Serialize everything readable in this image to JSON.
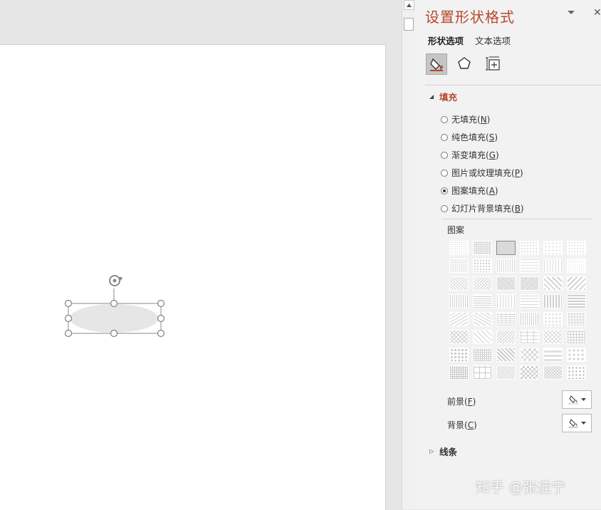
{
  "panel": {
    "title": "设置形状格式",
    "tabs": [
      {
        "label": "形状选项",
        "active": true
      },
      {
        "label": "文本选项",
        "active": false
      }
    ],
    "category_icons": [
      "fill-line-icon",
      "effects-pentagon-icon",
      "size-properties-icon"
    ]
  },
  "fill_section": {
    "header": "填充",
    "options": [
      {
        "label": "无填充(N)",
        "text": "无填充(",
        "key": "N",
        "end": ")",
        "checked": false
      },
      {
        "label": "纯色填充(S)",
        "text": "纯色填充(",
        "key": "S",
        "end": ")",
        "checked": false
      },
      {
        "label": "渐变填充(G)",
        "text": "渐变填充(",
        "key": "G",
        "end": ")",
        "checked": false
      },
      {
        "label": "图片或纹理填充(P)",
        "text": "图片或纹理填充(",
        "key": "P",
        "end": ")",
        "checked": false
      },
      {
        "label": "图案填充(A)",
        "text": "图案填充(",
        "key": "A",
        "end": ")",
        "checked": true
      },
      {
        "label": "幻灯片背景填充(B)",
        "text": "幻灯片背景填充(",
        "key": "B",
        "end": ")",
        "checked": false
      }
    ],
    "pattern_label": "图案",
    "pattern_count": 48,
    "selected_pattern_index": 2,
    "foreground": {
      "label": "前景(F)",
      "text": "前景(",
      "key": "F",
      "end": ")"
    },
    "background": {
      "label": "背景(C)",
      "text": "背景(",
      "key": "C",
      "end": ")"
    }
  },
  "line_section": {
    "header": "线条"
  },
  "watermark": "知乎 @张佳宁",
  "colors": {
    "accent": "#b7472a",
    "panel_bg": "#f2f2f2",
    "shape_fill": "#e3e3e3"
  }
}
